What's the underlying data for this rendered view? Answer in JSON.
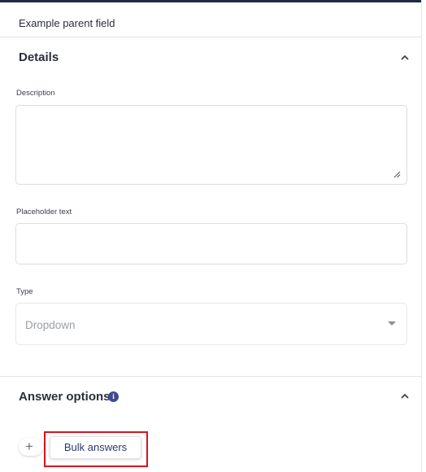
{
  "parent_field": {
    "label": "Example parent field"
  },
  "details": {
    "title": "Details",
    "collapse_icon": "chevron-up-icon",
    "description": {
      "label": "Description",
      "value": ""
    },
    "placeholder": {
      "label": "Placeholder text",
      "value": ""
    },
    "type": {
      "label": "Type",
      "selected": "Dropdown"
    }
  },
  "answer_options": {
    "title": "Answer options",
    "info_icon": "info-icon",
    "info_glyph": "i",
    "collapse_icon": "chevron-up-icon",
    "add_glyph": "+",
    "bulk_button_label": "Bulk answers"
  },
  "colors": {
    "top_bar": "#1f2a44",
    "highlight": "#d6141c",
    "info_icon": "#3f4a8e",
    "bulk_text": "#2a3a6e"
  }
}
